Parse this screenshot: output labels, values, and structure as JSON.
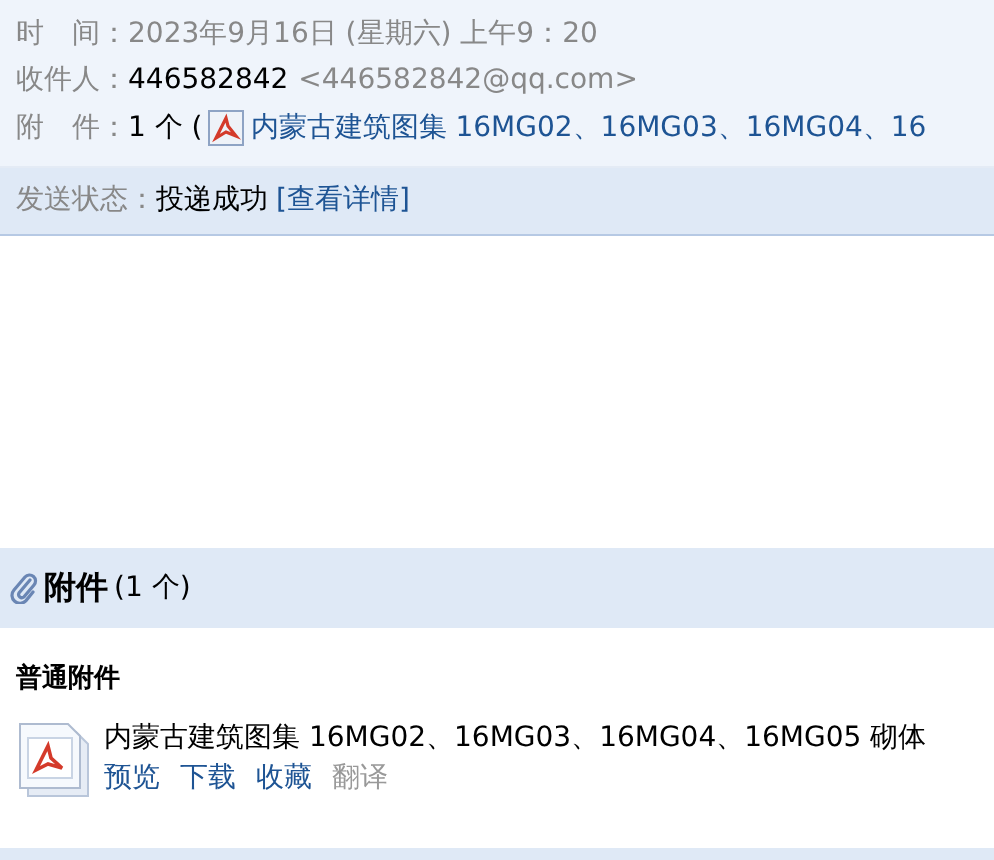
{
  "header": {
    "fields": [
      {
        "kind": "plain",
        "label": "时　间：",
        "value": "2023年9月16日 (星期六) 上午9：20"
      },
      {
        "kind": "recipient",
        "label": "收件人：",
        "name": "446582842",
        "address": "<446582842@qq.com>"
      },
      {
        "kind": "attachment",
        "label": "附　件：",
        "count": "1 个 (",
        "file": "内蒙古建筑图集 16MG02、16MG03、16MG04、16"
      }
    ]
  },
  "status": {
    "label": "发送状态：",
    "value": "投递成功",
    "link": "[查看详情]"
  },
  "attachments": {
    "title": "附件",
    "count": "(1 个)",
    "group": "普通附件",
    "files": [
      {
        "name": "内蒙古建筑图集 16MG02、16MG03、16MG04、16MG05 砌体",
        "actions": [
          {
            "label": "预览",
            "disabled": false
          },
          {
            "label": "下载",
            "disabled": false
          },
          {
            "label": "收藏",
            "disabled": false
          },
          {
            "label": "翻译",
            "disabled": true
          }
        ]
      }
    ]
  }
}
